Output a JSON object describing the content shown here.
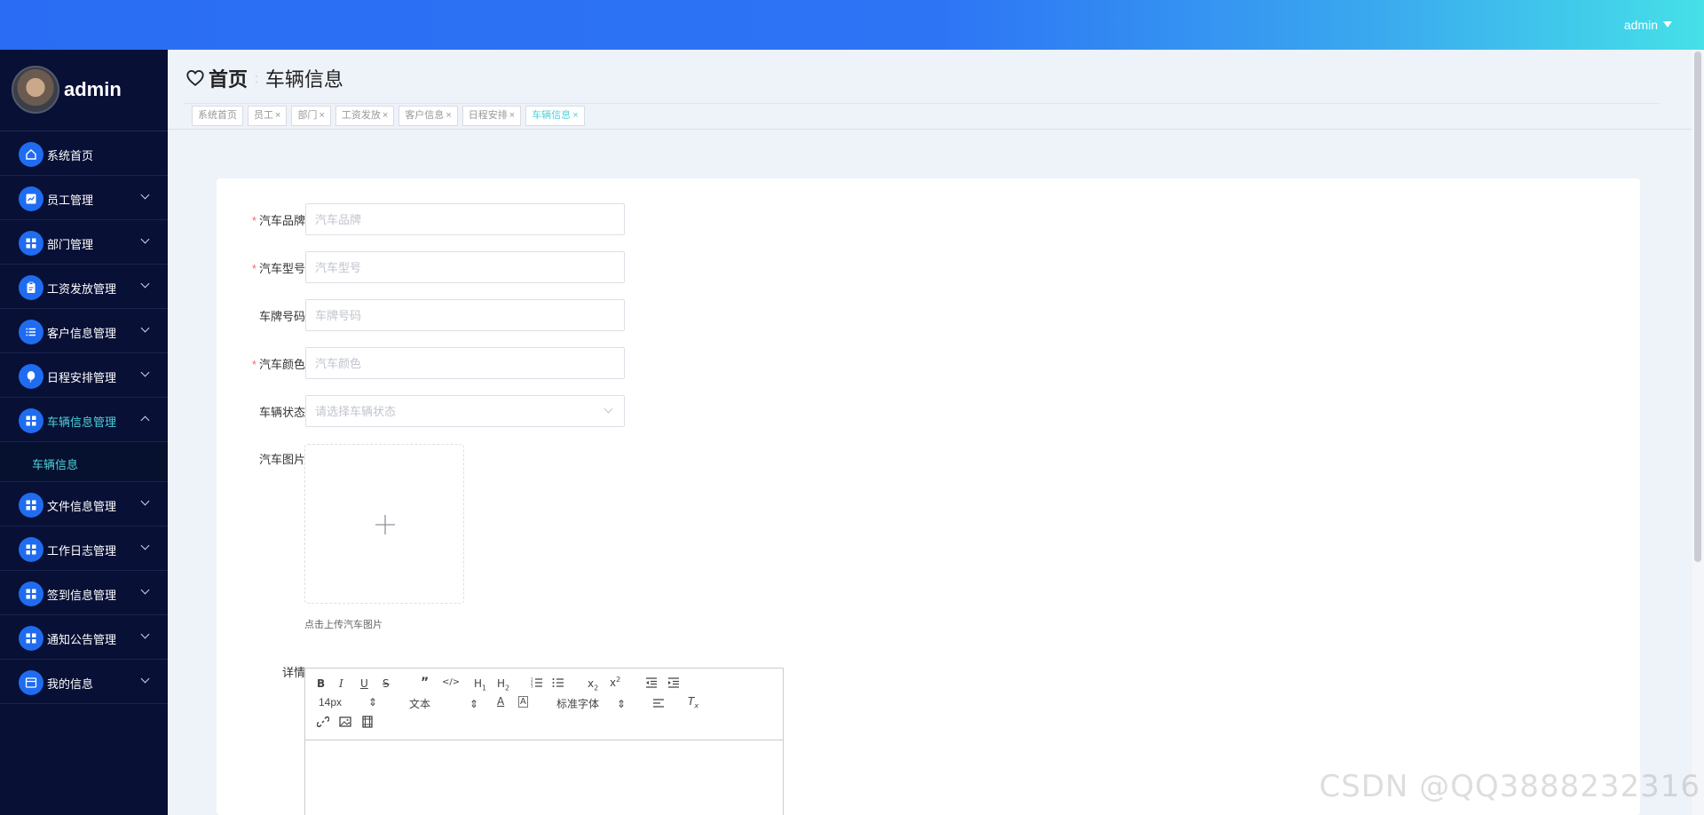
{
  "topbar": {
    "user": "admin"
  },
  "sidebar": {
    "profile_name": "admin",
    "items": [
      {
        "label": "系统首页",
        "icon": "home-icon",
        "has_arrow": false
      },
      {
        "label": "员工管理",
        "icon": "chart-icon",
        "has_arrow": true
      },
      {
        "label": "部门管理",
        "icon": "grid-icon",
        "has_arrow": true
      },
      {
        "label": "工资发放管理",
        "icon": "clipboard-icon",
        "has_arrow": true
      },
      {
        "label": "客户信息管理",
        "icon": "list-icon",
        "has_arrow": true
      },
      {
        "label": "日程安排管理",
        "icon": "balloon-icon",
        "has_arrow": true
      },
      {
        "label": "车辆信息管理",
        "icon": "grid-icon",
        "has_arrow": true,
        "open": true
      },
      {
        "label": "文件信息管理",
        "icon": "grid-icon",
        "has_arrow": true
      },
      {
        "label": "工作日志管理",
        "icon": "grid-icon",
        "has_arrow": true
      },
      {
        "label": "签到信息管理",
        "icon": "grid-icon",
        "has_arrow": true
      },
      {
        "label": "通知公告管理",
        "icon": "grid-icon",
        "has_arrow": true
      },
      {
        "label": "我的信息",
        "icon": "card-icon",
        "has_arrow": true
      }
    ],
    "submenu_label": "车辆信息"
  },
  "breadcrumb": {
    "home": "首页",
    "separator": ":",
    "current": "车辆信息"
  },
  "tabs": [
    {
      "label": "系统首页",
      "closable": false
    },
    {
      "label": "员工",
      "closable": true
    },
    {
      "label": "部门",
      "closable": true
    },
    {
      "label": "工资发放",
      "closable": true
    },
    {
      "label": "客户信息",
      "closable": true
    },
    {
      "label": "日程安排",
      "closable": true
    },
    {
      "label": "车辆信息",
      "closable": true,
      "active": true
    }
  ],
  "form": {
    "brand_label": "汽车品牌",
    "brand_placeholder": "汽车品牌",
    "model_label": "汽车型号",
    "model_placeholder": "汽车型号",
    "plate_label": "车牌号码",
    "plate_placeholder": "车牌号码",
    "color_label": "汽车颜色",
    "color_placeholder": "汽车颜色",
    "status_label": "车辆状态",
    "status_placeholder": "请选择车辆状态",
    "image_label": "汽车图片",
    "image_hint": "点击上传汽车图片",
    "detail_label": "详情"
  },
  "editor": {
    "font_size": "14px",
    "block_type": "文本",
    "font_family": "标准字体"
  },
  "watermark": "CSDN @QQ3888232316",
  "colors": {
    "accent": "#2a6df4",
    "active_teal": "#4fd1d8",
    "sidebar_bg": "#081036",
    "required": "#f56c6c"
  }
}
